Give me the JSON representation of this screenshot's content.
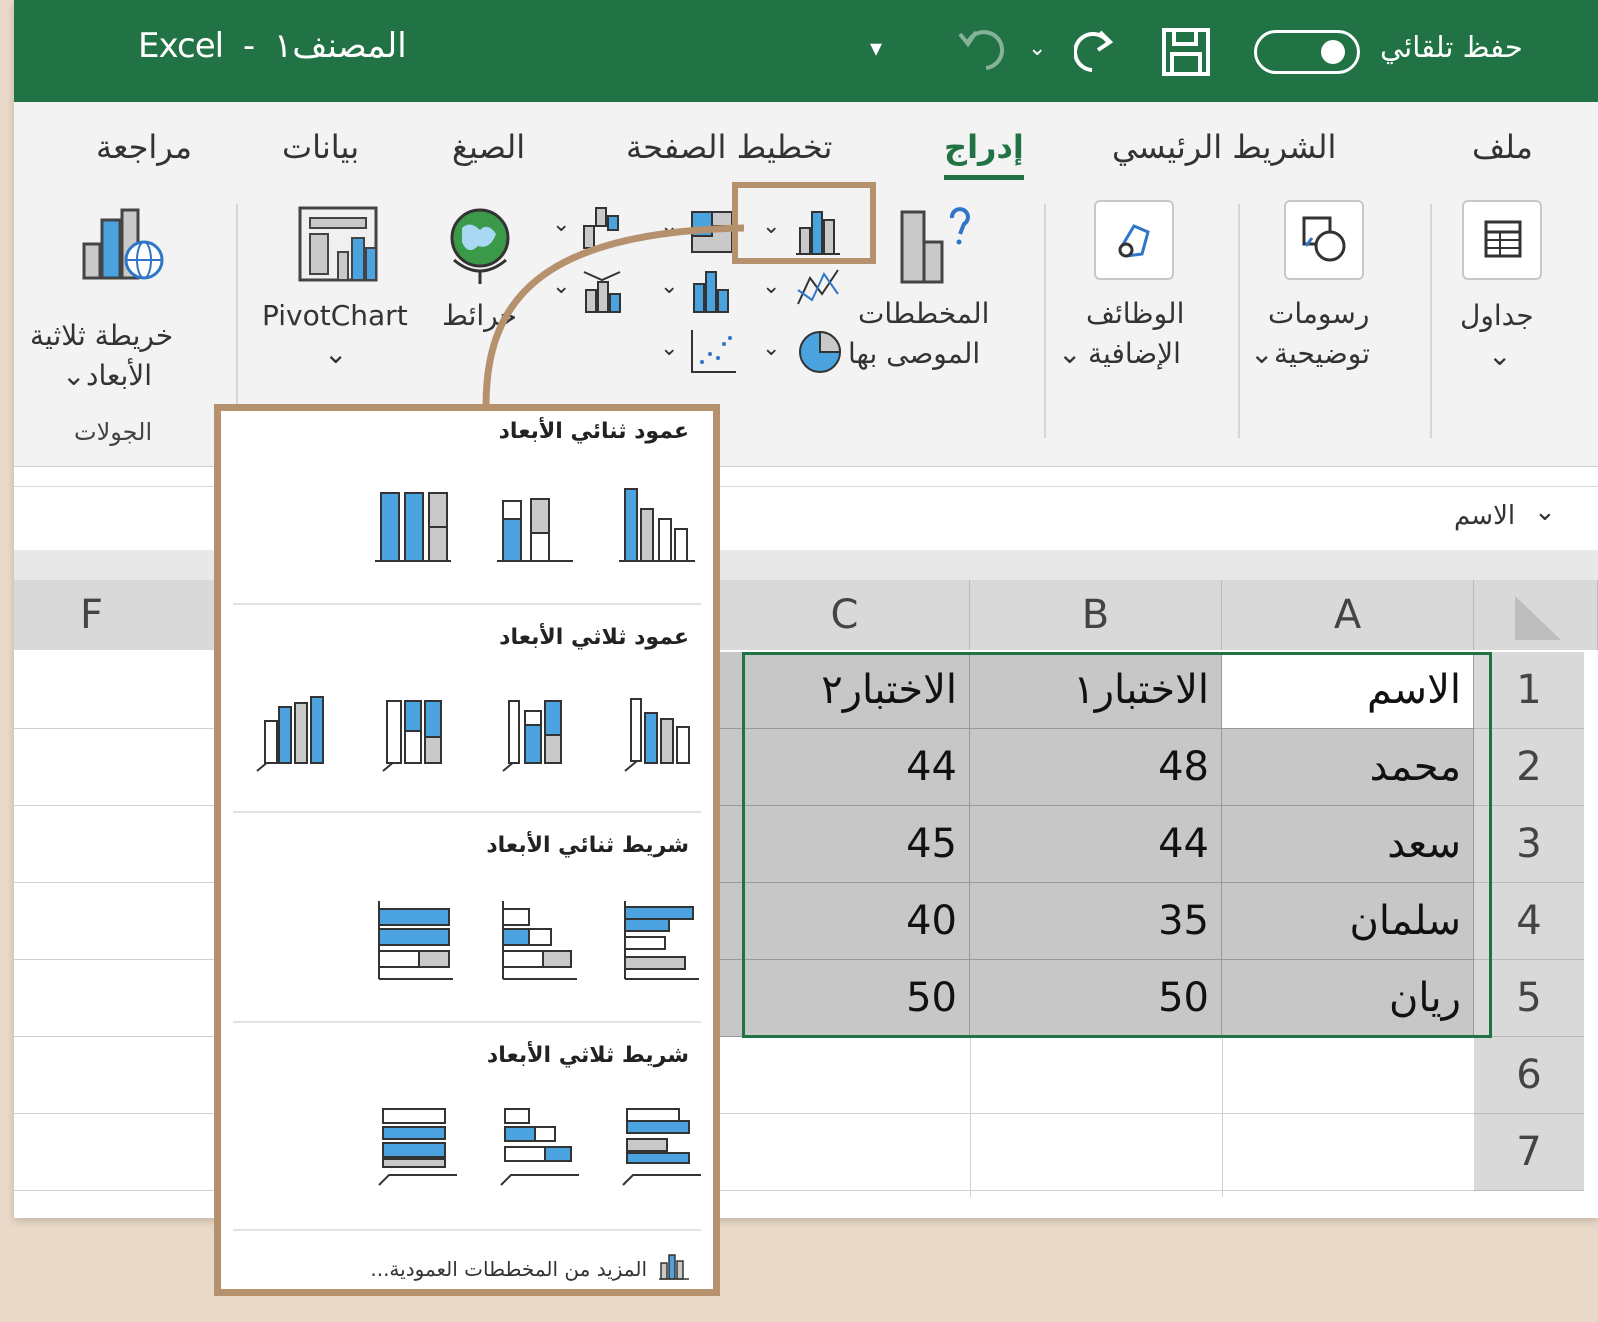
{
  "titlebar": {
    "app": "Excel",
    "separator": "-",
    "workbook": "المصنف١",
    "autosave_label": "حفظ تلقائي"
  },
  "menu_tabs": [
    {
      "label": "ملف"
    },
    {
      "label": "الشريط الرئيسي"
    },
    {
      "label": "إدراج",
      "active": true
    },
    {
      "label": "تخطيط الصفحة"
    },
    {
      "label": "الصيغ"
    },
    {
      "label": "بيانات"
    },
    {
      "label": "مراجعة"
    }
  ],
  "ribbon": {
    "tables": "جداول",
    "illustrations_1": "رسومات",
    "illustrations_2": "توضيحية",
    "addins_1": "الوظائف",
    "addins_2": "الإضافية",
    "recommended_1": "المخططات",
    "recommended_2": "الموصى بها",
    "maps": "خرائط",
    "pivotchart": "PivotChart",
    "map3d_1": "خريطة ثلاثية",
    "map3d_2": "الأبعاد",
    "tours_group": "الجولات"
  },
  "formula_bar": {
    "name_box": "الاسم"
  },
  "columns": [
    "A",
    "B",
    "C",
    "F"
  ],
  "rows": [
    "1",
    "2",
    "3",
    "4",
    "5",
    "6",
    "7"
  ],
  "table": {
    "headers": [
      "الاسم",
      "الاختبار١",
      "الاختبار٢"
    ],
    "data": [
      [
        "محمد",
        "48",
        "44"
      ],
      [
        "سعد",
        "44",
        "45"
      ],
      [
        "سلمان",
        "35",
        "40"
      ],
      [
        "ريان",
        "50",
        "50"
      ]
    ]
  },
  "chart_menu": {
    "sec1": "عمود ثنائي الأبعاد",
    "sec2": "عمود ثلاثي الأبعاد",
    "sec3": "شريط ثنائي الأبعاد",
    "sec4": "شريط ثلاثي الأبعاد",
    "more": "المزيد من المخططات العمودية..."
  },
  "colors": {
    "excel_green": "#217346",
    "highlight": "#b5916e",
    "chart_blue": "#4aa3df",
    "chart_gray": "#b9b9b9"
  }
}
